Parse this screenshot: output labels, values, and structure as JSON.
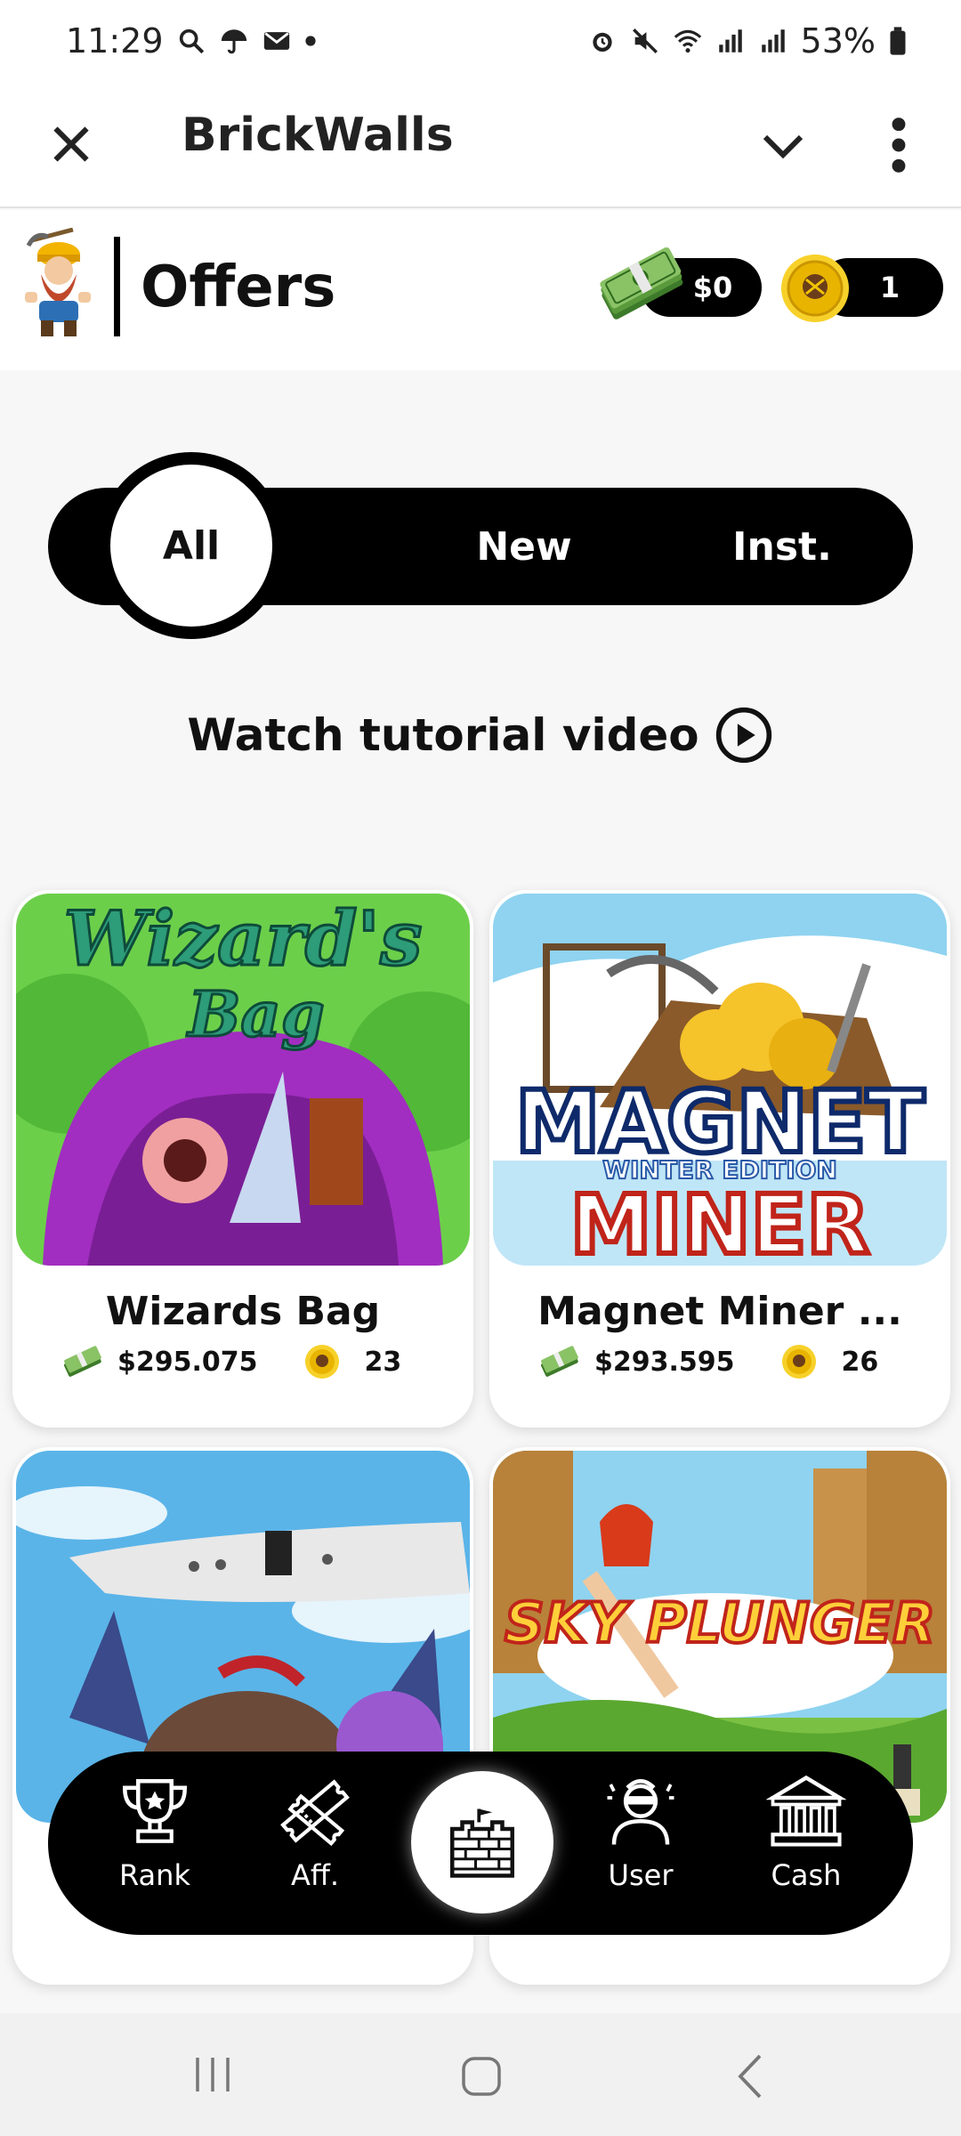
{
  "status_bar": {
    "time": "11:29",
    "battery": "53%",
    "icons": [
      "search-icon",
      "umbrella-icon",
      "mail-icon",
      "dot-icon",
      "alarm-icon",
      "mute-icon",
      "wifi-icon",
      "signal-icon",
      "signal-icon",
      "battery-icon"
    ]
  },
  "app_bar": {
    "title": "BrickWalls",
    "close_icon": "close-icon",
    "dropdown_icon": "chevron-down-icon",
    "menu_icon": "more-vertical-icon"
  },
  "header": {
    "title": "Offers",
    "cash_balance": "$0",
    "coin_balance": "1"
  },
  "filter": {
    "options": [
      "All",
      "New",
      "Inst."
    ],
    "selected": "All"
  },
  "tutorial": {
    "label": "Watch tutorial video"
  },
  "offers": [
    {
      "name": "Wizards Bag",
      "price": "$295.075",
      "coins": "23",
      "theme": "wizard"
    },
    {
      "name": "Magnet Miner ...",
      "price": "$293.595",
      "coins": "26",
      "theme": "miner"
    },
    {
      "name": "",
      "price": "",
      "coins": "",
      "theme": "sky"
    },
    {
      "name": "",
      "price": "",
      "coins": "",
      "theme": "plunger"
    }
  ],
  "nav": {
    "rank": "Rank",
    "aff": "Aff.",
    "user": "User",
    "cash": "Cash"
  },
  "colors": {
    "accent": "#000000",
    "coin_gold": "#f2c400",
    "cash_green": "#3d7a2a"
  }
}
